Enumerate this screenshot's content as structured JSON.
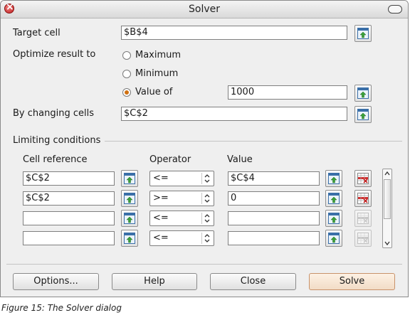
{
  "window": {
    "title": "Solver"
  },
  "target": {
    "label": "Target cell",
    "value": "$B$4"
  },
  "optimize": {
    "label": "Optimize result to",
    "options": [
      {
        "label": "Maximum",
        "checked": false
      },
      {
        "label": "Minimum",
        "checked": false
      },
      {
        "label": "Value of",
        "checked": true
      }
    ],
    "value_of": "1000"
  },
  "changing": {
    "label": "By changing cells",
    "value": "$C$2"
  },
  "limits": {
    "title": "Limiting conditions",
    "headers": {
      "cell_reference": "Cell reference",
      "operator": "Operator",
      "value": "Value"
    },
    "rows": [
      {
        "cell": "$C$2",
        "operator": "<=",
        "value": "$C$4"
      },
      {
        "cell": "$C$2",
        "operator": ">=",
        "value": "0"
      },
      {
        "cell": "",
        "operator": "<=",
        "value": ""
      },
      {
        "cell": "",
        "operator": "<=",
        "value": ""
      }
    ]
  },
  "buttons": {
    "options": "Options...",
    "help": "Help",
    "close": "Close",
    "solve": "Solve"
  },
  "caption": "Figure 15: The Solver dialog",
  "colors": {
    "accent": "#d07010",
    "default_button": "#f2dcc6"
  }
}
